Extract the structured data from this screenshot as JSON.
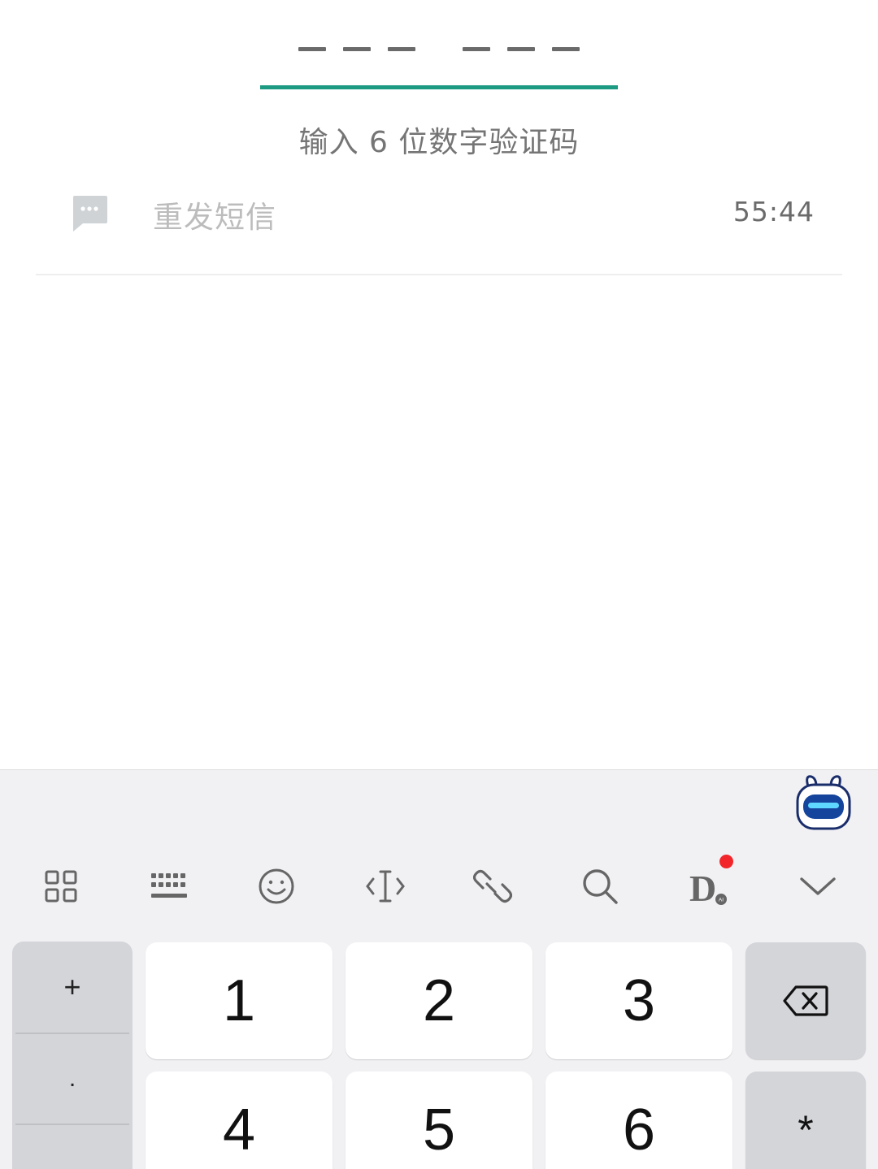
{
  "verification": {
    "code_slots": [
      "",
      "",
      "",
      "",
      "",
      ""
    ],
    "hint": "输入 6 位数字验证码",
    "accent_color": "#1d9a82"
  },
  "resend": {
    "icon": "message-bubble-icon",
    "label": "重发短信",
    "countdown": "55:44"
  },
  "keyboard": {
    "toolbar_icons": [
      "grid-icon",
      "keyboard-icon",
      "emoji-icon",
      "text-cursor-icon",
      "link-icon",
      "search-icon",
      "d-ai-icon",
      "collapse-chevron-icon"
    ],
    "ai_badge": "AI",
    "side_keys": [
      "+",
      ".",
      ""
    ],
    "keys": {
      "k1": "1",
      "k2": "2",
      "k3": "3",
      "k4": "4",
      "k5": "5",
      "k6": "6"
    },
    "star_key": "*",
    "backspace_icon": "backspace-icon",
    "notification_color": "#f2262a"
  }
}
